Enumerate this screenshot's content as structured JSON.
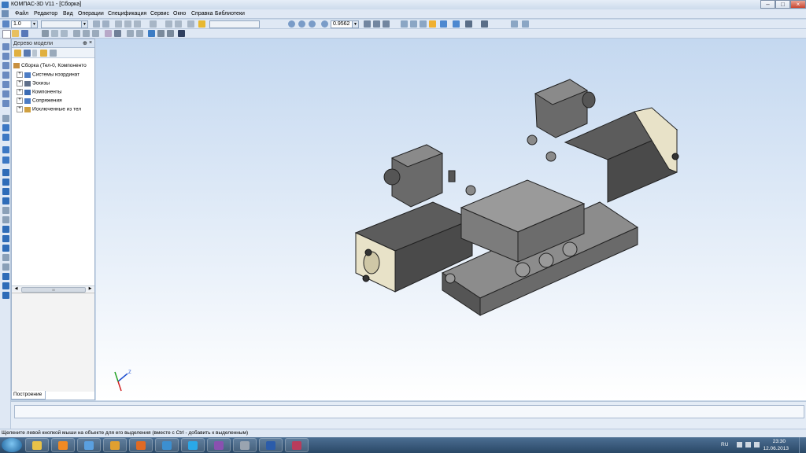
{
  "window": {
    "title": "КОМПАС-3D V11 - [Сборка]",
    "controls": {
      "minimize": "–",
      "maximize": "□",
      "close": "×"
    }
  },
  "menu": {
    "items": [
      "Файл",
      "Редактор",
      "Вид",
      "Операции",
      "Спецификация",
      "Сервис",
      "Окно",
      "Справка",
      "Библиотеки"
    ]
  },
  "toolbar": {
    "step_value": "1.0",
    "zoom_value": "0.9562"
  },
  "tree": {
    "header_title": "Дерево модели",
    "pin_glyph": "⊕",
    "close_glyph": "×",
    "items": [
      {
        "label": "Сборка (Тел-0, Компоненто",
        "icon": "assembly-icon",
        "expander": ""
      },
      {
        "label": "Системы координат",
        "icon": "coordinate-system-icon",
        "expander": "+"
      },
      {
        "label": "Эскизы",
        "icon": "sketch-icon",
        "expander": "+"
      },
      {
        "label": "Компоненты",
        "icon": "components-icon",
        "expander": "+"
      },
      {
        "label": "Сопряжения",
        "icon": "mates-icon",
        "expander": "+"
      },
      {
        "label": "Исключенные из тел",
        "icon": "excluded-icon",
        "expander": "+"
      }
    ],
    "scroll_grip": "III",
    "tab_label": "Построение"
  },
  "viewport": {
    "axis_label_z": "Z"
  },
  "status": {
    "hint": "Щелкните левой кнопкой мыши на объекте для его выделения (вместе с Ctrl - добавить к выделенным)"
  },
  "taskbar": {
    "language": "RU",
    "time": "23:30",
    "date": "12.06.2013",
    "apps": [
      {
        "name": "explorer",
        "color": "#e8c248"
      },
      {
        "name": "media-player",
        "color": "#f08a24"
      },
      {
        "name": "kompas",
        "color": "#5aa0e0"
      },
      {
        "name": "archive",
        "color": "#e0a030"
      },
      {
        "name": "firefox",
        "color": "#e06a24"
      },
      {
        "name": "app-globe",
        "color": "#3c8fd0"
      },
      {
        "name": "skype",
        "color": "#2aa8e8"
      },
      {
        "name": "app-purple",
        "color": "#8a50b0"
      },
      {
        "name": "app-gray",
        "color": "#9aa4b0"
      },
      {
        "name": "word",
        "color": "#2b5caa"
      },
      {
        "name": "winrar",
        "color": "#b83c5c"
      }
    ]
  },
  "colors": {
    "accent": "#3a78c0",
    "model_body": "#6f6f6f",
    "model_end_cap": "#e8e2c8"
  }
}
